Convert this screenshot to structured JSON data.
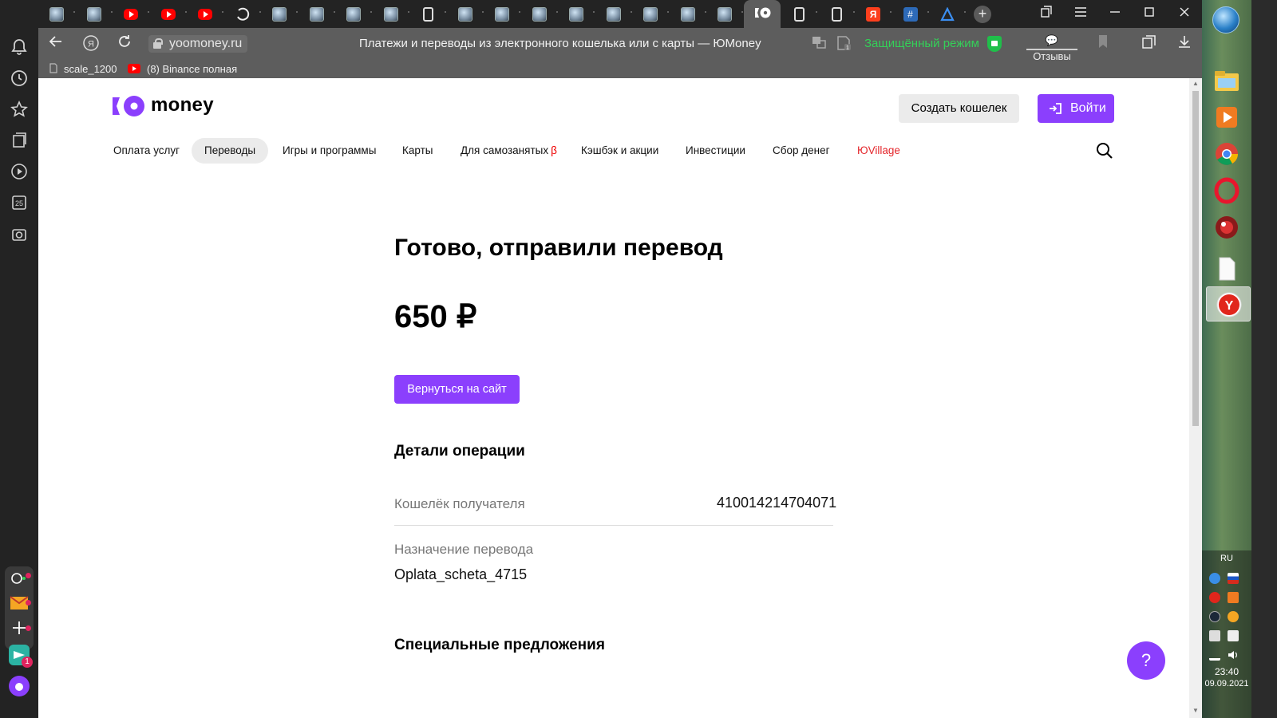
{
  "browser": {
    "url": "yoomoney.ru",
    "page_title": "Платежи и переводы из электронного кошелька или с карты — ЮMoney",
    "secure_mode_label": "Защищённый режим",
    "reviews_label": "Отзывы",
    "bookmarks": [
      {
        "label": "scale_1200",
        "icon": "doc-icon"
      },
      {
        "label": "(8) Binance полная",
        "icon": "youtube-icon"
      }
    ],
    "tabs": [
      "globe",
      "globe",
      "youtube",
      "youtube",
      "youtube",
      "spinner",
      "globe",
      "globe",
      "globe",
      "globe",
      "doc",
      "globe",
      "globe",
      "globe",
      "globe",
      "globe",
      "globe",
      "globe",
      "globe",
      "yoomoney",
      "doc",
      "doc",
      "yandex",
      "hash",
      "triangle"
    ],
    "left_sidebar_badge": "1"
  },
  "site": {
    "logo_text": "money",
    "create_wallet_label": "Создать кошелек",
    "login_label": "Войти",
    "nav": [
      {
        "label": "Оплата услуг"
      },
      {
        "label": "Переводы",
        "active": true
      },
      {
        "label": "Игры и программы"
      },
      {
        "label": "Карты"
      },
      {
        "label": "Для самозанятых",
        "suffix": "β"
      },
      {
        "label": "Кэшбэк и акции"
      },
      {
        "label": "Инвестиции"
      },
      {
        "label": "Сбор денег"
      },
      {
        "label": "ЮVillage",
        "highlight": true
      }
    ]
  },
  "result": {
    "title": "Готово, отправили перевод",
    "amount": "650 ₽",
    "back_button": "Вернуться на сайт",
    "details_heading": "Детали операции",
    "recipient_label": "Кошелёк получателя",
    "recipient_value": "410014214704071",
    "purpose_label": "Назначение перевода",
    "purpose_value": "Oplata_scheta_4715",
    "offers_heading": "Специальные предложения",
    "help_label": "?"
  },
  "taskbar": {
    "lang": "RU",
    "time": "23:40",
    "date": "09.09.2021"
  },
  "colors": {
    "brand_purple": "#8b3ffd",
    "secure_green": "#34d058",
    "nav_red": "#e4262b"
  }
}
